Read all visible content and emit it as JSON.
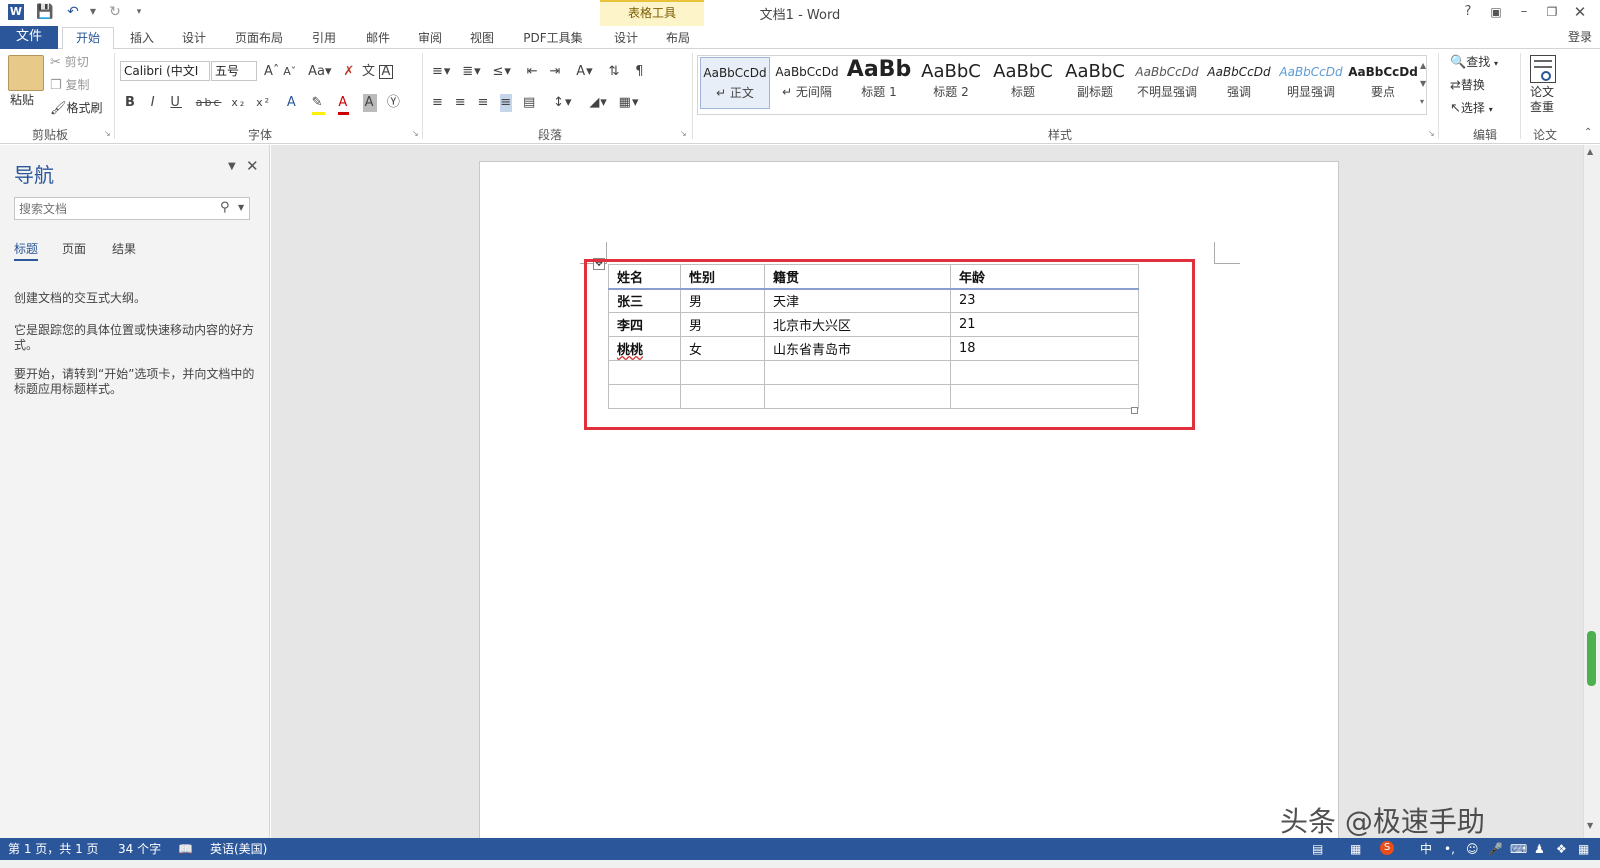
{
  "window": {
    "title": "文档1 - Word",
    "context_tool": "表格工具",
    "signin": "登录"
  },
  "tabs": [
    "文件",
    "开始",
    "插入",
    "设计",
    "页面布局",
    "引用",
    "邮件",
    "审阅",
    "视图",
    "PDF工具集",
    "设计",
    "布局"
  ],
  "clipboard": {
    "paste": "粘贴",
    "cut": "剪切",
    "copy": "复制",
    "format_painter": "格式刷",
    "label": "剪贴板"
  },
  "font": {
    "name": "Calibri (中文I",
    "size": "五号",
    "label": "字体"
  },
  "paragraph": {
    "label": "段落"
  },
  "styles": {
    "label": "样式",
    "items": [
      {
        "preview": "AaBbCcDd",
        "name": "正文"
      },
      {
        "preview": "AaBbCcDd",
        "name": "无间隔"
      },
      {
        "preview": "AaBb",
        "name": "标题 1"
      },
      {
        "preview": "AaBbC",
        "name": "标题 2"
      },
      {
        "preview": "AaBbC",
        "name": "标题"
      },
      {
        "preview": "AaBbC",
        "name": "副标题"
      },
      {
        "preview": "AaBbCcDd",
        "name": "不明显强调"
      },
      {
        "preview": "AaBbCcDd",
        "name": "强调"
      },
      {
        "preview": "AaBbCcDd",
        "name": "明显强调"
      },
      {
        "preview": "AaBbCcDd",
        "name": "要点"
      }
    ]
  },
  "editing": {
    "find": "查找",
    "replace": "替换",
    "select": "选择",
    "label": "编辑"
  },
  "paper": {
    "check_line1": "论文",
    "check_line2": "查重",
    "label": "论文"
  },
  "nav": {
    "title": "导航",
    "search_placeholder": "搜索文档",
    "tabs": [
      "标题",
      "页面",
      "结果"
    ],
    "help": [
      "创建文档的交互式大纲。",
      "它是跟踪您的具体位置或快速移动内容的好方式。",
      "要开始，请转到“开始”选项卡，并向文档中的标题应用标题样式。"
    ]
  },
  "table": {
    "header": [
      "姓名",
      "性别",
      "籍贯",
      "年龄"
    ],
    "rows": [
      [
        "张三",
        "男",
        "天津",
        "23"
      ],
      [
        "李四",
        "男",
        "北京市大兴区",
        "21"
      ],
      [
        "桃桃",
        "女",
        "山东省青岛市",
        "18"
      ],
      [
        "",
        "",
        "",
        ""
      ],
      [
        "",
        "",
        "",
        ""
      ]
    ]
  },
  "status": {
    "page": "第 1 页，共 1 页",
    "words": "34 个字",
    "language": "英语(美国)"
  },
  "watermark": "头条 @极速手助",
  "colors": {
    "accent": "#2b579a",
    "highlight_box": "#e0303c",
    "context_tab": "#fdf4c9"
  }
}
